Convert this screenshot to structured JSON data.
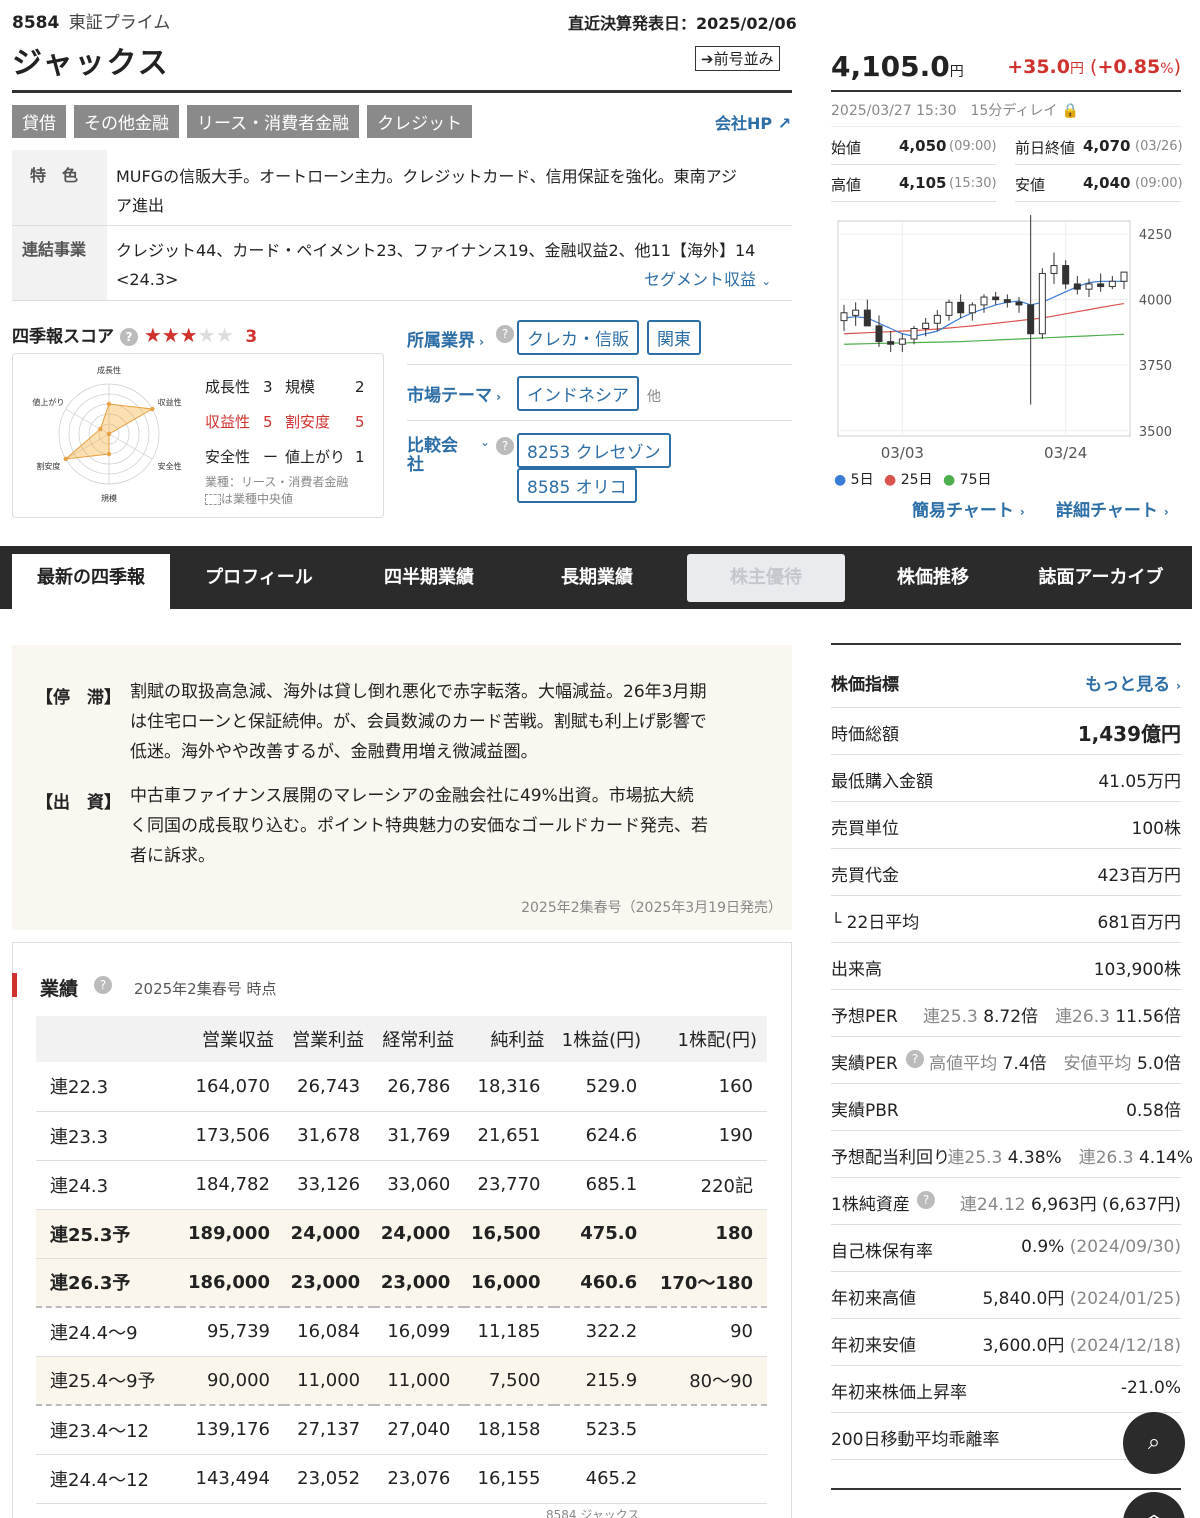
{
  "header": {
    "code": "8584",
    "market": "東証プライム",
    "earnings_date": "直近決算発表日：2025/02/06",
    "company": "ジャックス",
    "prev_issue_button": "前号並み",
    "tags": [
      "貸借",
      "その他金融",
      "リース・消費者金融",
      "クレジット"
    ],
    "company_hp": "会社HP"
  },
  "profile": {
    "feature_label": "特　色",
    "feature_text_1": "MUFGの信販大手。オートローン主力。クレジットカード、信用保証を強化。東南アジ",
    "feature_text_2": "ア進出",
    "segment_label": "連結事業",
    "segment_text_1": "クレジット44、カード・ペイメント23、ファイナンス19、金融収益2、他11【海外】14",
    "segment_text_2": "<24.3>",
    "segment_link": "セグメント収益"
  },
  "score": {
    "title": "四季報スコア",
    "value": "3",
    "stars": "★★★",
    "stars_empty": "★★",
    "items": [
      {
        "label": "成長性",
        "value": "3"
      },
      {
        "label": "規模",
        "value": "2"
      },
      {
        "label": "収益性",
        "value": "5"
      },
      {
        "label": "割安度",
        "value": "5"
      },
      {
        "label": "安全性",
        "value": "ー"
      },
      {
        "label": "値上がり",
        "value": "1"
      }
    ],
    "radar_labels": [
      "成長性",
      "収益性",
      "安全性",
      "規模",
      "割安度",
      "値上がり"
    ],
    "radar_values": [
      3,
      5,
      0,
      2,
      5,
      1
    ],
    "note_1": "業種：リース・消費者金融",
    "note_2": "は業種中央値"
  },
  "industry": {
    "label": "所属業界",
    "tags": [
      "クレカ・信販",
      "関東"
    ],
    "theme_label": "市場テーマ",
    "theme_tag": "インドネシア",
    "theme_more": "他",
    "compare_label_1": "比較会",
    "compare_label_2": "社",
    "compare_tags": [
      "8253 クレセゾン",
      "8585 オリコ"
    ]
  },
  "price": {
    "value": "4,105.0",
    "unit": "円",
    "change": "+35.0",
    "change_unit": "円",
    "change_pct": "+0.85",
    "datetime": "2025/03/27 15:30",
    "delay": "15分ディレイ",
    "open_label": "始値",
    "open": "4,050",
    "open_time": "(09:00)",
    "prev_label": "前日終値",
    "prev": "4,070",
    "prev_date": "(03/26)",
    "high_label": "高値",
    "high": "4,105",
    "high_time": "(15:30)",
    "low_label": "安値",
    "low": "4,040",
    "low_time": "(09:00)"
  },
  "chart_data": {
    "type": "candlestick",
    "x_ticks": [
      "03/03",
      "03/24"
    ],
    "y_ticks": [
      4250,
      4000,
      3750,
      3500
    ],
    "ylim": [
      3480,
      4300
    ],
    "candles": [
      {
        "o": 3920,
        "h": 3980,
        "l": 3880,
        "c": 3950
      },
      {
        "o": 3940,
        "h": 3990,
        "l": 3900,
        "c": 3960
      },
      {
        "o": 3960,
        "h": 4000,
        "l": 3920,
        "c": 3900
      },
      {
        "o": 3900,
        "h": 3940,
        "l": 3820,
        "c": 3840
      },
      {
        "o": 3840,
        "h": 3880,
        "l": 3800,
        "c": 3830
      },
      {
        "o": 3830,
        "h": 3870,
        "l": 3800,
        "c": 3850
      },
      {
        "o": 3850,
        "h": 3900,
        "l": 3830,
        "c": 3890
      },
      {
        "o": 3890,
        "h": 3930,
        "l": 3860,
        "c": 3910
      },
      {
        "o": 3910,
        "h": 3960,
        "l": 3880,
        "c": 3940
      },
      {
        "o": 3940,
        "h": 4000,
        "l": 3920,
        "c": 3990
      },
      {
        "o": 3990,
        "h": 4020,
        "l": 3930,
        "c": 3950
      },
      {
        "o": 3950,
        "h": 3990,
        "l": 3920,
        "c": 3980
      },
      {
        "o": 3980,
        "h": 4020,
        "l": 3950,
        "c": 4010
      },
      {
        "o": 4010,
        "h": 4030,
        "l": 3980,
        "c": 4000
      },
      {
        "o": 4000,
        "h": 4020,
        "l": 3970,
        "c": 3990
      },
      {
        "o": 3990,
        "h": 4010,
        "l": 3950,
        "c": 3980
      },
      {
        "o": 3980,
        "h": 4380,
        "l": 3600,
        "c": 3870
      },
      {
        "o": 3870,
        "h": 4120,
        "l": 3850,
        "c": 4100
      },
      {
        "o": 4100,
        "h": 4180,
        "l": 4060,
        "c": 4130
      },
      {
        "o": 4130,
        "h": 4150,
        "l": 4040,
        "c": 4060
      },
      {
        "o": 4060,
        "h": 4090,
        "l": 4020,
        "c": 4040
      },
      {
        "o": 4040,
        "h": 4080,
        "l": 4010,
        "c": 4060
      },
      {
        "o": 4060,
        "h": 4100,
        "l": 4030,
        "c": 4050
      },
      {
        "o": 4050,
        "h": 4090,
        "l": 4040,
        "c": 4070
      },
      {
        "o": 4070,
        "h": 4105,
        "l": 4040,
        "c": 4105
      }
    ],
    "ma5": [
      3930,
      3935,
      3930,
      3910,
      3890,
      3870,
      3860,
      3870,
      3880,
      3905,
      3930,
      3950,
      3965,
      3980,
      3990,
      3995,
      3980,
      3990,
      4010,
      4030,
      4050,
      4065,
      4070,
      4070,
      4070
    ],
    "ma25": [
      3870,
      3872,
      3874,
      3876,
      3878,
      3880,
      3882,
      3885,
      3888,
      3892,
      3896,
      3900,
      3905,
      3910,
      3915,
      3920,
      3925,
      3930,
      3938,
      3946,
      3954,
      3962,
      3970,
      3978,
      3985
    ],
    "ma75": [
      3830,
      3831,
      3832,
      3833,
      3834,
      3835,
      3836,
      3837,
      3838,
      3839,
      3840,
      3842,
      3844,
      3846,
      3848,
      3850,
      3852,
      3854,
      3856,
      3858,
      3860,
      3862,
      3864,
      3866,
      3868
    ],
    "legend": [
      "5日",
      "25日",
      "75日"
    ],
    "colors": {
      "ma5": "#3a7bd5",
      "ma25": "#d9534f",
      "ma75": "#4cae4c"
    }
  },
  "chart_links": {
    "simple": "簡易チャート",
    "detail": "詳細チャート"
  },
  "nav": {
    "tabs": [
      "最新の四季報",
      "プロフィール",
      "四半期業績",
      "長期業績",
      "株主優待",
      "株価推移",
      "誌面アーカイブ"
    ]
  },
  "news": {
    "h1": "【停　滞】",
    "t1": [
      "割賦の取扱高急減、海外は貸し倒れ悪化で赤字転落。大幅減益。26年3月期",
      "は住宅ローンと保証続伸。が、会員数減のカード苦戦。割賦も利上げ影響で",
      "低迷。海外やや改善するが、金融費用増え微減益圏。"
    ],
    "h2": "【出　資】",
    "t2": [
      "中古車ファイナンス展開のマレーシアの金融会社に49%出資。市場拡大続",
      "く同国の成長取り込む。ポイント特典魅力の安価なゴールドカード発売、若",
      "者に訴求。"
    ],
    "source": "2025年2集春号（2025年3月19日発売）"
  },
  "performance": {
    "title": "業績",
    "asof": "2025年2集春号 時点",
    "headers": [
      "",
      "営業収益",
      "営業利益",
      "経常利益",
      "純利益",
      "1株益(円)",
      "1株配(円)"
    ],
    "rows": [
      {
        "c": [
          "連22.3",
          "164,070",
          "26,743",
          "26,786",
          "18,316",
          "529.0",
          "160"
        ],
        "type": ""
      },
      {
        "c": [
          "連23.3",
          "173,506",
          "31,678",
          "31,769",
          "21,651",
          "624.6",
          "190"
        ],
        "type": ""
      },
      {
        "c": [
          "連24.3",
          "184,782",
          "33,126",
          "33,060",
          "23,770",
          "685.1",
          "220記"
        ],
        "type": ""
      },
      {
        "c": [
          "連25.3予",
          "189,000",
          "24,000",
          "24,000",
          "16,500",
          "475.0",
          "180"
        ],
        "type": "fc"
      },
      {
        "c": [
          "連26.3予",
          "186,000",
          "23,000",
          "23,000",
          "16,000",
          "460.6",
          "170〜180"
        ],
        "type": "fc dash"
      },
      {
        "c": [
          "連24.4〜9",
          "95,739",
          "16,084",
          "16,099",
          "11,185",
          "322.2",
          "90"
        ],
        "type": ""
      },
      {
        "c": [
          "連25.4〜9予",
          "90,000",
          "11,000",
          "11,000",
          "7,500",
          "215.9",
          "80〜90"
        ],
        "type": "fcl dash"
      },
      {
        "c": [
          "連23.4〜12",
          "139,176",
          "27,137",
          "27,040",
          "18,158",
          "523.5",
          ""
        ],
        "type": ""
      },
      {
        "c": [
          "連24.4〜12",
          "143,494",
          "23,052",
          "23,076",
          "16,155",
          "465.2",
          ""
        ],
        "type": ""
      }
    ],
    "footer": "8584 ジャックス"
  },
  "indicators": {
    "title": "株価指標",
    "more": "もっと見る",
    "rows": [
      {
        "label": "時価総額",
        "value": "1,439億円",
        "bold": true
      },
      {
        "label": "最低購入金額",
        "value": "41.05万円"
      },
      {
        "label": "売買単位",
        "value": "100株"
      },
      {
        "label": "売買代金",
        "value": "423百万円"
      },
      {
        "label": "└ 22日平均",
        "value": "681百万円"
      },
      {
        "label": "出来高",
        "value": "103,900株"
      }
    ],
    "per_label": "予想PER",
    "per_a_lbl": "連25.3",
    "per_a": "8.72倍",
    "per_b_lbl": "連26.3",
    "per_b": "11.56倍",
    "aper_label": "実績PER",
    "aper_a_lbl": "高値平均",
    "aper_a": "7.4倍",
    "aper_b_lbl": "安値平均",
    "aper_b": "5.0倍",
    "pbr_label": "実績PBR",
    "pbr": "0.58倍",
    "div_label": "予想配当利回り",
    "div_a_lbl": "連25.3",
    "div_a": "4.38%",
    "div_b_lbl": "連26.3",
    "div_b": "4.14%",
    "bps_label": "1株純資産",
    "bps_lbl": "連24.12",
    "bps": "6,963円 (6,637円)",
    "own_label": "自己株保有率",
    "own": "0.9%",
    "own_date": "(2024/09/30)",
    "yh_label": "年初来高値",
    "yh": "5,840.0円",
    "yh_date": "(2024/01/25)",
    "yl_label": "年初来安値",
    "yl": "3,600.0円",
    "yl_date": "(2024/12/18)",
    "yr_label": "年初来株価上昇率",
    "yr": "-21.0%",
    "ma200_label": "200日移動平均乖離率"
  }
}
